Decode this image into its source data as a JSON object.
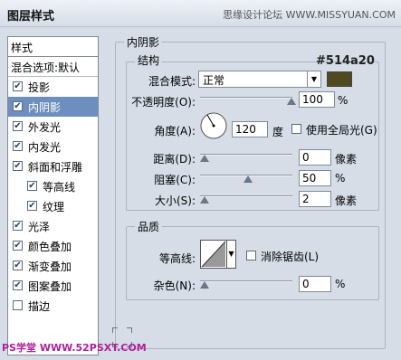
{
  "window": {
    "title": "图层样式",
    "site_watermark": "思缘设计论坛  WWW.MISSYUAN.COM"
  },
  "styles_panel": {
    "header": "样式",
    "blend_options": "混合选项:默认",
    "items": [
      {
        "label": "投影",
        "checked": true,
        "selected": false,
        "sub": false
      },
      {
        "label": "内阴影",
        "checked": true,
        "selected": true,
        "sub": false
      },
      {
        "label": "外发光",
        "checked": true,
        "selected": false,
        "sub": false
      },
      {
        "label": "内发光",
        "checked": true,
        "selected": false,
        "sub": false
      },
      {
        "label": "斜面和浮雕",
        "checked": true,
        "selected": false,
        "sub": false
      },
      {
        "label": "等高线",
        "checked": true,
        "selected": false,
        "sub": true
      },
      {
        "label": "纹理",
        "checked": true,
        "selected": false,
        "sub": true
      },
      {
        "label": "光泽",
        "checked": true,
        "selected": false,
        "sub": false
      },
      {
        "label": "颜色叠加",
        "checked": true,
        "selected": false,
        "sub": false
      },
      {
        "label": "渐变叠加",
        "checked": true,
        "selected": false,
        "sub": false
      },
      {
        "label": "图案叠加",
        "checked": true,
        "selected": false,
        "sub": false
      },
      {
        "label": "描边",
        "checked": false,
        "selected": false,
        "sub": false
      }
    ]
  },
  "inner_shadow": {
    "legend": "内阴影",
    "structure": {
      "legend": "结构",
      "color_annotation": "#514a20",
      "color_swatch": "#514a20",
      "blend_mode_label": "混合模式:",
      "blend_mode_value": "正常",
      "opacity_label": "不透明度(O):",
      "opacity_value": "100",
      "opacity_unit": "%",
      "opacity_fraction": 1.0,
      "angle_label": "角度(A):",
      "angle_value": "120",
      "angle_unit": "度",
      "global_light_label": "使用全局光(G)",
      "global_light_checked": false,
      "distance_label": "距离(D):",
      "distance_value": "0",
      "distance_unit": "像素",
      "distance_fraction": 0.0,
      "choke_label": "阻塞(C):",
      "choke_value": "50",
      "choke_unit": "%",
      "choke_fraction": 0.5,
      "size_label": "大小(S):",
      "size_value": "2",
      "size_unit": "像素",
      "size_fraction": 0.0
    },
    "quality": {
      "legend": "品质",
      "contour_label": "等高线:",
      "anti_alias_label": "消除锯齿(L)",
      "anti_alias_checked": false,
      "noise_label": "杂色(N):",
      "noise_value": "0",
      "noise_unit": "%",
      "noise_fraction": 0.0
    }
  },
  "footer_watermark": "PS学堂  WWW.52PSXT.COM"
}
